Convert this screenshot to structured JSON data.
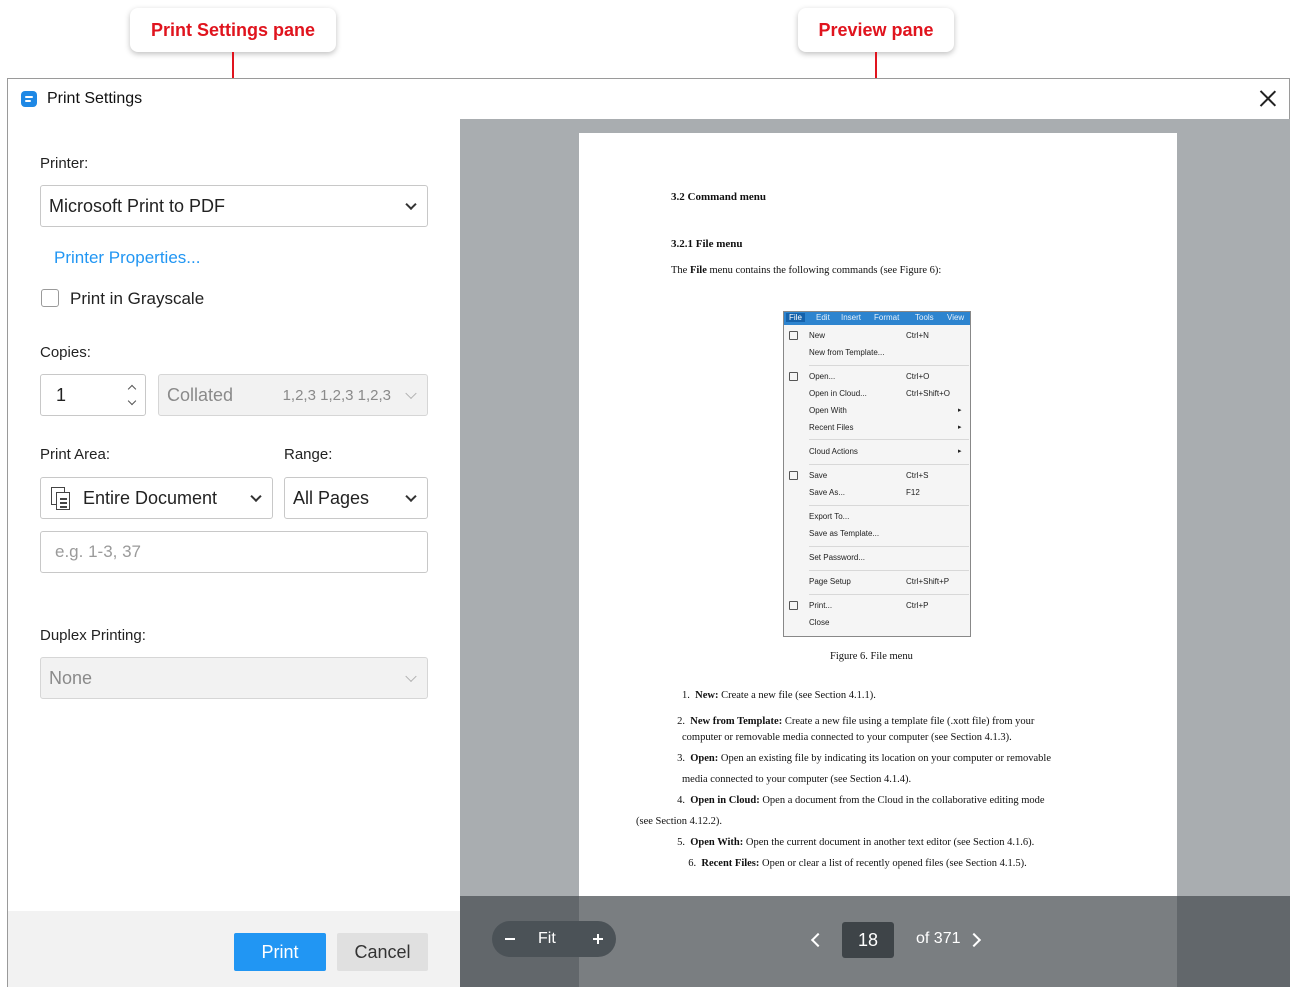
{
  "callouts": {
    "settings": "Print Settings pane",
    "preview": "Preview pane"
  },
  "window": {
    "title": "Print Settings"
  },
  "settings": {
    "printer_label": "Printer:",
    "printer_value": "Microsoft Print to PDF",
    "printer_properties_link": "Printer Properties...",
    "grayscale_label": "Print in Grayscale",
    "grayscale_checked": false,
    "copies_label": "Copies:",
    "copies_value": "1",
    "collated_value": "Collated",
    "collated_hint": "1,2,3 1,2,3 1,2,3",
    "print_area_label": "Print Area:",
    "print_area_value": "Entire Document",
    "range_label": "Range:",
    "range_value": "All Pages",
    "pages_placeholder": "e.g. 1-3, 37",
    "duplex_label": "Duplex Printing:",
    "duplex_value": "None",
    "print_button": "Print",
    "cancel_button": "Cancel"
  },
  "preview": {
    "page": {
      "h_section": "3.2 Command menu",
      "h_sub": "3.2.1 File menu",
      "intro_pre": "The ",
      "intro_bold": "File",
      "intro_post": " menu contains the following commands (see Figure 6):",
      "menu_bar": [
        "File",
        "Edit",
        "Insert",
        "Format",
        "Tools",
        "View"
      ],
      "menu_items": [
        {
          "label": "New",
          "shortcut": "Ctrl+N"
        },
        {
          "label": "New from Template...",
          "shortcut": ""
        },
        {
          "label": "Open...",
          "shortcut": "Ctrl+O"
        },
        {
          "label": "Open in Cloud...",
          "shortcut": "Ctrl+Shift+O"
        },
        {
          "label": "Open With",
          "shortcut": ""
        },
        {
          "label": "Recent Files",
          "shortcut": ""
        },
        {
          "label": "Cloud Actions",
          "shortcut": ""
        },
        {
          "label": "Save",
          "shortcut": "Ctrl+S"
        },
        {
          "label": "Save As...",
          "shortcut": "F12"
        },
        {
          "label": "Export To...",
          "shortcut": ""
        },
        {
          "label": "Save as Template...",
          "shortcut": ""
        },
        {
          "label": "Set Password...",
          "shortcut": ""
        },
        {
          "label": "Page Setup",
          "shortcut": "Ctrl+Shift+P"
        },
        {
          "label": "Print...",
          "shortcut": "Ctrl+P"
        },
        {
          "label": "Close",
          "shortcut": ""
        }
      ],
      "caption": "Figure 6. File menu",
      "items": [
        {
          "num": "1.",
          "bold": "New:",
          "text": " Create a new file (see Section 4.1.1)."
        },
        {
          "num": "2.",
          "bold": "New from Template:",
          "text": " Create a new file using a template file (.xott file) from your",
          "cont": "computer or removable media connected to your computer (see Section 4.1.3)."
        },
        {
          "num": "3.",
          "bold": "Open:",
          "text": " Open an existing file by indicating its location on your computer or removable",
          "cont": "media connected to your computer (see Section 4.1.4)."
        },
        {
          "num": "4.",
          "bold": "Open in Cloud:",
          "text": " Open a document from the Cloud in the collaborative editing mode",
          "cont": "(see Section 4.12.2)."
        },
        {
          "num": "5.",
          "bold": "Open With:",
          "text": " Open the current document in another text editor (see Section 4.1.6)."
        },
        {
          "num": "6.",
          "bold": "Recent Files:",
          "text": " Open or clear a list of recently opened files (see Section 4.1.5)."
        }
      ]
    },
    "zoom_label": "Fit",
    "current_page": "18",
    "total_pages": "of 371"
  }
}
